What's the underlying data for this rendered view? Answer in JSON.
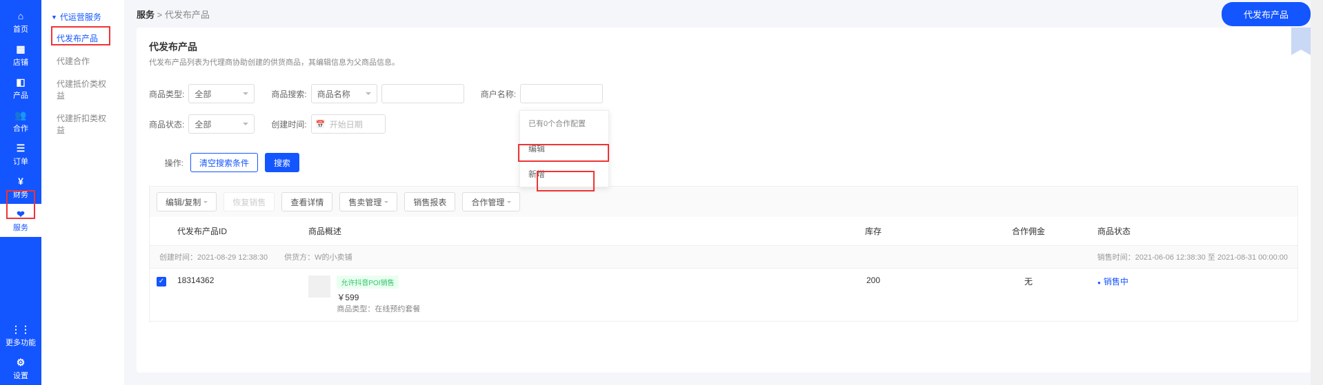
{
  "rail": {
    "items": [
      {
        "icon": "home",
        "label": "首页"
      },
      {
        "icon": "shop",
        "label": "店铺"
      },
      {
        "icon": "product",
        "label": "产品"
      },
      {
        "icon": "partner",
        "label": "合作"
      },
      {
        "icon": "order",
        "label": "订单"
      },
      {
        "icon": "finance",
        "label": "财务"
      },
      {
        "icon": "service",
        "label": "服务"
      }
    ],
    "bottom": [
      {
        "icon": "more",
        "label": "更多功能"
      },
      {
        "icon": "settings",
        "label": "设置"
      }
    ]
  },
  "sidebar": {
    "title": "代运营服务",
    "items": [
      {
        "label": "代发布产品",
        "active": true
      },
      {
        "label": "代建合作"
      },
      {
        "label": "代建抵价类权益"
      },
      {
        "label": "代建折扣类权益"
      }
    ]
  },
  "breadcrumb": {
    "root": "服务",
    "sep": ">",
    "current": "代发布产品"
  },
  "top_button": "代发布产品",
  "card": {
    "title": "代发布产品",
    "sub": "代发布产品列表为代理商协助创建的供货商品，其编辑信息为父商品信息。"
  },
  "filters": {
    "type_label": "商品类型:",
    "type_value": "全部",
    "search_label": "商品搜索:",
    "search_by": "商品名称",
    "merchant_label": "商户名称:",
    "status_label": "商品状态:",
    "status_value": "全部",
    "create_label": "创建时间:",
    "date_placeholder": "开始日期",
    "op_label": "操作:",
    "clear": "清空搜索条件",
    "search_btn": "搜索"
  },
  "popup": {
    "head": "已有0个合作配置",
    "edit": "编辑",
    "new": "新增"
  },
  "actions": {
    "edit_copy": "编辑/复制",
    "restore": "恢复销售",
    "detail": "查看详情",
    "sale_mgmt": "售卖管理",
    "report": "销售报表",
    "coop_mgmt": "合作管理"
  },
  "columns": {
    "id": "代发布产品ID",
    "desc": "商品概述",
    "stock": "库存",
    "commission": "合作佣金",
    "status": "商品状态"
  },
  "meta": {
    "create_time_label": "创建时间：",
    "create_time": "2021-08-29 12:38:30",
    "supplier_label": "供货方：",
    "supplier": "W的小卖铺",
    "sale_time_label": "销售时间：",
    "sale_time": "2021-06-06 12:38:30 至 2021-08-31 00:00:00"
  },
  "row": {
    "id": "18314362",
    "tag": "允许抖音POI销售",
    "price": "￥599",
    "type_label": "商品类型：",
    "type_value": "在线预约套餐",
    "stock": "200",
    "commission": "无",
    "status": "销售中"
  }
}
